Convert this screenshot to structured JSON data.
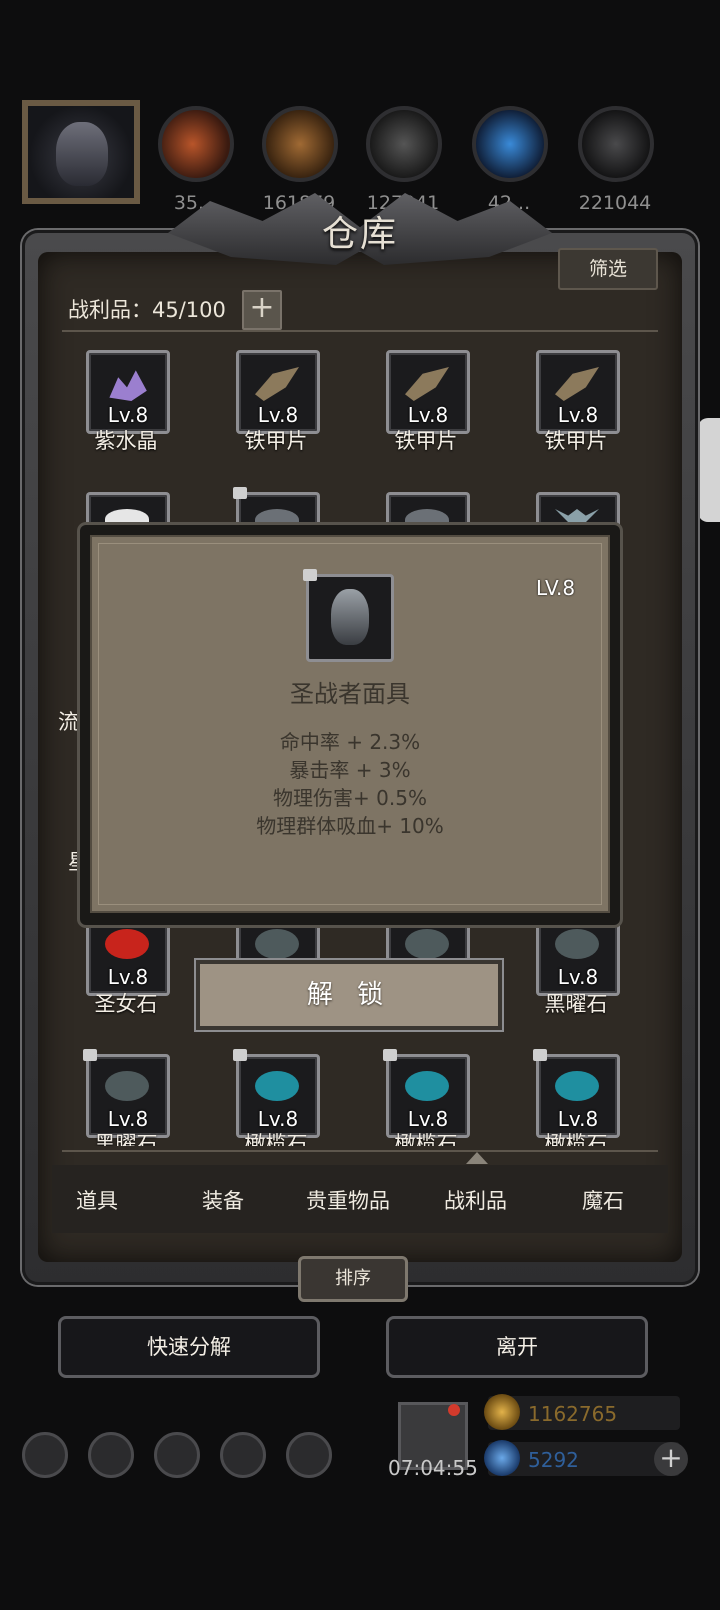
{
  "top_bar": {
    "resources": [
      {
        "icon": "meat-icon",
        "value": "35...",
        "color": "#7a3a1c"
      },
      {
        "icon": "wood-icon",
        "value": "161879",
        "color": "#8a5a2c"
      },
      {
        "icon": "stone-icon",
        "value": "127341",
        "color": "#3c3c3c"
      },
      {
        "icon": "crystal-icon",
        "value": "42...",
        "color": "#2c6ab8"
      },
      {
        "icon": "iron-icon",
        "value": "221044",
        "color": "#2e2e30"
      }
    ]
  },
  "panel": {
    "title": "仓库",
    "filter_label": "筛选",
    "loot_label": "战利品：45/100",
    "plus_label": "+"
  },
  "items_row1": [
    {
      "level": "Lv.8",
      "name": "紫水晶",
      "color": "#9b7fcf",
      "locked": false
    },
    {
      "level": "Lv.8",
      "name": "铁甲片",
      "color": "#8c7a5c",
      "locked": false
    },
    {
      "level": "Lv.8",
      "name": "铁甲片",
      "color": "#8c7a5c",
      "locked": false
    },
    {
      "level": "Lv.8",
      "name": "铁甲片",
      "color": "#8c7a5c",
      "locked": false
    }
  ],
  "items_row2_peek": {
    "colors": [
      "#e6e6e6",
      "#6b7076",
      "#6b7076",
      "#8aa0a8"
    ]
  },
  "peek_texts": {
    "left1": "流",
    "left2": "星"
  },
  "items_row4": [
    {
      "level": "Lv.8",
      "name": "圣女石",
      "color": "#c8241c",
      "locked": false
    },
    {
      "level": "Lv.8",
      "name": "",
      "color": "#4e5a5c",
      "locked": true
    },
    {
      "level": "Lv.8",
      "name": "",
      "color": "#4e5a5c",
      "locked": true
    },
    {
      "level": "Lv.8",
      "name": "黑曜石",
      "color": "#4e5a5c",
      "locked": true
    }
  ],
  "items_row5": [
    {
      "level": "Lv.8",
      "name": "黑曜石",
      "color": "#4e5a5c",
      "locked": true
    },
    {
      "level": "Lv.8",
      "name": "橄榄石",
      "color": "#1f8fa0",
      "locked": true
    },
    {
      "level": "Lv.8",
      "name": "橄榄石",
      "color": "#1f8fa0",
      "locked": true
    },
    {
      "level": "Lv.8",
      "name": "橄榄石",
      "color": "#1f8fa0",
      "locked": true
    }
  ],
  "popup": {
    "level": "LV.8",
    "item_name": "圣战者面具",
    "stats": [
      "命中率 + 2.3%",
      "暴击率 + 3%",
      "物理伤害+ 0.5%",
      "物理群体吸血+ 10%"
    ],
    "unlock_label": "解 锁"
  },
  "tabs": [
    "道具",
    "装备",
    "贵重物品",
    "战利品",
    "魔石"
  ],
  "active_tab": "战利品",
  "sort_label": "排序",
  "quick_decompose_label": "快速分解",
  "leave_label": "离开",
  "bottom": {
    "timer": "07:04:55",
    "gold": "1162765",
    "gems": "5292",
    "add_label": "+",
    "gold_color": "#8a6a2c",
    "gem_color": "#2f5f9a"
  }
}
